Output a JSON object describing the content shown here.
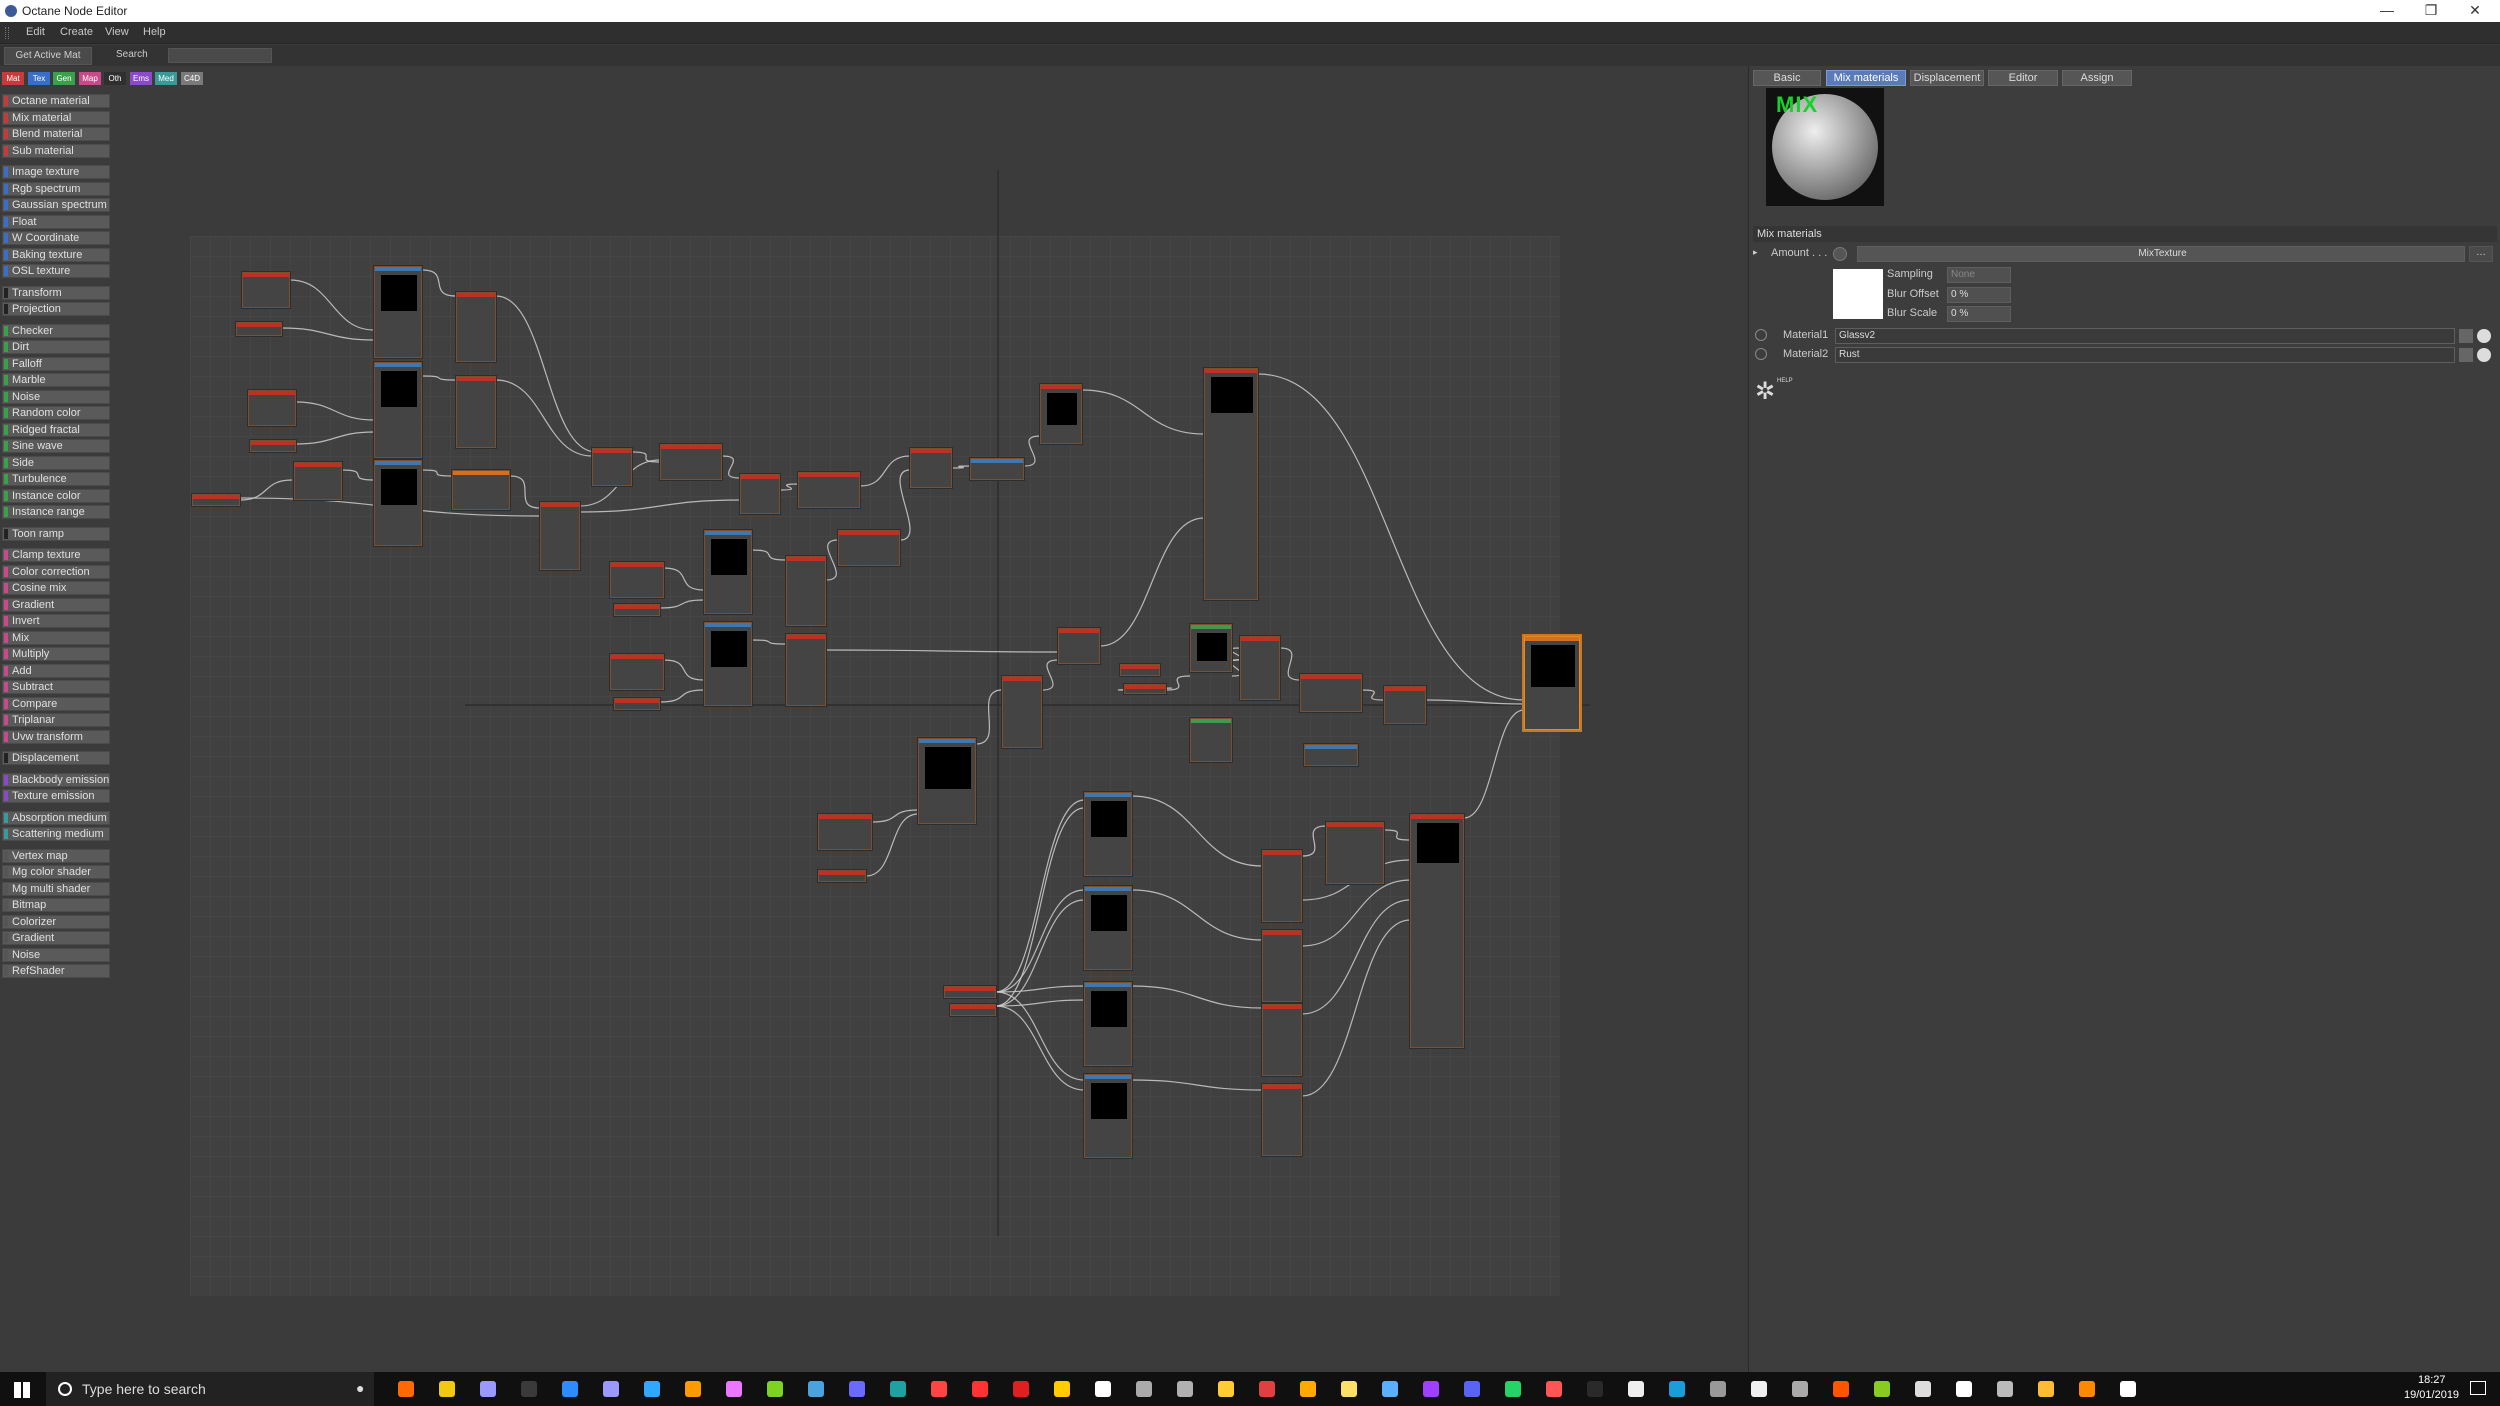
{
  "window": {
    "title": "Octane Node Editor",
    "minimize": "—",
    "restore": "❐",
    "close": "✕"
  },
  "menu": [
    "Edit",
    "Create",
    "View",
    "Help"
  ],
  "toolbar": {
    "get_active": "Get Active Mat",
    "search_label": "Search",
    "search_value": ""
  },
  "categories": [
    {
      "label": "Mat",
      "color": "#c93a3a"
    },
    {
      "label": "Tex",
      "color": "#3a6fc9"
    },
    {
      "label": "Gen",
      "color": "#3aa04a"
    },
    {
      "label": "Map",
      "color": "#c94a8a"
    },
    {
      "label": "Oth",
      "color": "#2f2f2f"
    },
    {
      "label": "Ems",
      "color": "#8a4ac9"
    },
    {
      "label": "Med",
      "color": "#3a9a9a"
    },
    {
      "label": "C4D",
      "color": "#7a7a7a"
    }
  ],
  "library": [
    {
      "label": "Octane material",
      "color": "#c83a3a"
    },
    {
      "label": "Mix material",
      "color": "#c83a3a"
    },
    {
      "label": "Blend material",
      "color": "#c83a3a"
    },
    {
      "label": "Sub material",
      "color": "#c83a3a"
    },
    {
      "label": "Image texture",
      "color": "#3a6fc9"
    },
    {
      "label": "Rgb spectrum",
      "color": "#3a6fc9"
    },
    {
      "label": "Gaussian spectrum",
      "color": "#3a6fc9"
    },
    {
      "label": "Float",
      "color": "#3a6fc9"
    },
    {
      "label": "W Coordinate",
      "color": "#3a6fc9"
    },
    {
      "label": "Baking texture",
      "color": "#3a6fc9"
    },
    {
      "label": "OSL texture",
      "color": "#3a6fc9"
    },
    {
      "label": "Transform",
      "color": "#222222"
    },
    {
      "label": "Projection",
      "color": "#222222"
    },
    {
      "label": "Checker",
      "color": "#3aa04a"
    },
    {
      "label": "Dirt",
      "color": "#3aa04a"
    },
    {
      "label": "Falloff",
      "color": "#3aa04a"
    },
    {
      "label": "Marble",
      "color": "#3aa04a"
    },
    {
      "label": "Noise",
      "color": "#3aa04a"
    },
    {
      "label": "Random color",
      "color": "#3aa04a"
    },
    {
      "label": "Ridged fractal",
      "color": "#3aa04a"
    },
    {
      "label": "Sine wave",
      "color": "#3aa04a"
    },
    {
      "label": "Side",
      "color": "#3aa04a"
    },
    {
      "label": "Turbulence",
      "color": "#3aa04a"
    },
    {
      "label": "Instance color",
      "color": "#3aa04a"
    },
    {
      "label": "Instance range",
      "color": "#3aa04a"
    },
    {
      "label": "Toon ramp",
      "color": "#222222"
    },
    {
      "label": "Clamp texture",
      "color": "#c94a8a"
    },
    {
      "label": "Color correction",
      "color": "#c94a8a"
    },
    {
      "label": "Cosine mix",
      "color": "#c94a8a"
    },
    {
      "label": "Gradient",
      "color": "#c94a8a"
    },
    {
      "label": "Invert",
      "color": "#c94a8a"
    },
    {
      "label": "Mix",
      "color": "#c94a8a"
    },
    {
      "label": "Multiply",
      "color": "#c94a8a"
    },
    {
      "label": "Add",
      "color": "#c94a8a"
    },
    {
      "label": "Subtract",
      "color": "#c94a8a"
    },
    {
      "label": "Compare",
      "color": "#c94a8a"
    },
    {
      "label": "Triplanar",
      "color": "#c94a8a"
    },
    {
      "label": "Uvw transform",
      "color": "#c94a8a"
    },
    {
      "label": "Displacement",
      "color": "#222222"
    },
    {
      "label": "Blackbody emission",
      "color": "#8a4ac9"
    },
    {
      "label": "Texture emission",
      "color": "#8a4ac9"
    },
    {
      "label": "Absorption medium",
      "color": "#3a9a9a"
    },
    {
      "label": "Scattering medium",
      "color": "#3a9a9a"
    },
    {
      "label": "Vertex map",
      "color": "#555555"
    },
    {
      "label": "Mg color shader",
      "color": "#555555"
    },
    {
      "label": "Mg multi shader",
      "color": "#555555"
    },
    {
      "label": "Bitmap",
      "color": "#555555"
    },
    {
      "label": "Colorizer",
      "color": "#555555"
    },
    {
      "label": "Gradient",
      "color": "#555555"
    },
    {
      "label": "Noise",
      "color": "#555555"
    },
    {
      "label": "RefShader",
      "color": "#555555"
    }
  ],
  "right_panel": {
    "tabs": [
      "Basic",
      "Mix materials",
      "Displacement",
      "Editor",
      "Assign"
    ],
    "active_tab": "Mix materials",
    "preview_label": "MIX",
    "section_title": "Mix materials",
    "amount_label": "Amount . . .",
    "amount_texture": "MixTexture",
    "sampling_label": "Sampling",
    "sampling_value": "None",
    "blur_offset_label": "Blur Offset",
    "blur_offset_value": "0 %",
    "blur_scale_label": "Blur Scale",
    "blur_scale_value": "0 %",
    "material1_label": "Material1",
    "material1_value": "Glassv2",
    "material2_label": "Material2",
    "material2_value": "Rust",
    "help_label": "HELP"
  },
  "taskbar": {
    "search_placeholder": "Type here to search",
    "time": "18:27",
    "date": "19/01/2019"
  }
}
